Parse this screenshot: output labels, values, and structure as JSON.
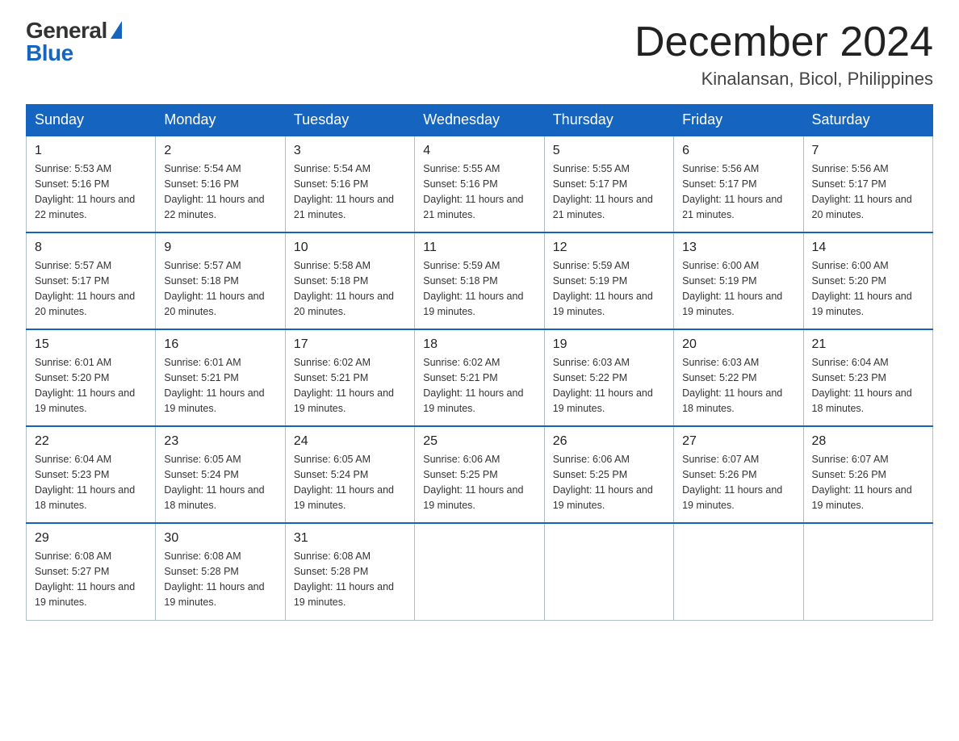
{
  "logo": {
    "text_general": "General",
    "text_blue": "Blue",
    "aria": "GeneralBlue logo"
  },
  "header": {
    "month_title": "December 2024",
    "location": "Kinalansan, Bicol, Philippines"
  },
  "days_of_week": [
    "Sunday",
    "Monday",
    "Tuesday",
    "Wednesday",
    "Thursday",
    "Friday",
    "Saturday"
  ],
  "weeks": [
    [
      {
        "day": "1",
        "sunrise": "Sunrise: 5:53 AM",
        "sunset": "Sunset: 5:16 PM",
        "daylight": "Daylight: 11 hours and 22 minutes."
      },
      {
        "day": "2",
        "sunrise": "Sunrise: 5:54 AM",
        "sunset": "Sunset: 5:16 PM",
        "daylight": "Daylight: 11 hours and 22 minutes."
      },
      {
        "day": "3",
        "sunrise": "Sunrise: 5:54 AM",
        "sunset": "Sunset: 5:16 PM",
        "daylight": "Daylight: 11 hours and 21 minutes."
      },
      {
        "day": "4",
        "sunrise": "Sunrise: 5:55 AM",
        "sunset": "Sunset: 5:16 PM",
        "daylight": "Daylight: 11 hours and 21 minutes."
      },
      {
        "day": "5",
        "sunrise": "Sunrise: 5:55 AM",
        "sunset": "Sunset: 5:17 PM",
        "daylight": "Daylight: 11 hours and 21 minutes."
      },
      {
        "day": "6",
        "sunrise": "Sunrise: 5:56 AM",
        "sunset": "Sunset: 5:17 PM",
        "daylight": "Daylight: 11 hours and 21 minutes."
      },
      {
        "day": "7",
        "sunrise": "Sunrise: 5:56 AM",
        "sunset": "Sunset: 5:17 PM",
        "daylight": "Daylight: 11 hours and 20 minutes."
      }
    ],
    [
      {
        "day": "8",
        "sunrise": "Sunrise: 5:57 AM",
        "sunset": "Sunset: 5:17 PM",
        "daylight": "Daylight: 11 hours and 20 minutes."
      },
      {
        "day": "9",
        "sunrise": "Sunrise: 5:57 AM",
        "sunset": "Sunset: 5:18 PM",
        "daylight": "Daylight: 11 hours and 20 minutes."
      },
      {
        "day": "10",
        "sunrise": "Sunrise: 5:58 AM",
        "sunset": "Sunset: 5:18 PM",
        "daylight": "Daylight: 11 hours and 20 minutes."
      },
      {
        "day": "11",
        "sunrise": "Sunrise: 5:59 AM",
        "sunset": "Sunset: 5:18 PM",
        "daylight": "Daylight: 11 hours and 19 minutes."
      },
      {
        "day": "12",
        "sunrise": "Sunrise: 5:59 AM",
        "sunset": "Sunset: 5:19 PM",
        "daylight": "Daylight: 11 hours and 19 minutes."
      },
      {
        "day": "13",
        "sunrise": "Sunrise: 6:00 AM",
        "sunset": "Sunset: 5:19 PM",
        "daylight": "Daylight: 11 hours and 19 minutes."
      },
      {
        "day": "14",
        "sunrise": "Sunrise: 6:00 AM",
        "sunset": "Sunset: 5:20 PM",
        "daylight": "Daylight: 11 hours and 19 minutes."
      }
    ],
    [
      {
        "day": "15",
        "sunrise": "Sunrise: 6:01 AM",
        "sunset": "Sunset: 5:20 PM",
        "daylight": "Daylight: 11 hours and 19 minutes."
      },
      {
        "day": "16",
        "sunrise": "Sunrise: 6:01 AM",
        "sunset": "Sunset: 5:21 PM",
        "daylight": "Daylight: 11 hours and 19 minutes."
      },
      {
        "day": "17",
        "sunrise": "Sunrise: 6:02 AM",
        "sunset": "Sunset: 5:21 PM",
        "daylight": "Daylight: 11 hours and 19 minutes."
      },
      {
        "day": "18",
        "sunrise": "Sunrise: 6:02 AM",
        "sunset": "Sunset: 5:21 PM",
        "daylight": "Daylight: 11 hours and 19 minutes."
      },
      {
        "day": "19",
        "sunrise": "Sunrise: 6:03 AM",
        "sunset": "Sunset: 5:22 PM",
        "daylight": "Daylight: 11 hours and 19 minutes."
      },
      {
        "day": "20",
        "sunrise": "Sunrise: 6:03 AM",
        "sunset": "Sunset: 5:22 PM",
        "daylight": "Daylight: 11 hours and 18 minutes."
      },
      {
        "day": "21",
        "sunrise": "Sunrise: 6:04 AM",
        "sunset": "Sunset: 5:23 PM",
        "daylight": "Daylight: 11 hours and 18 minutes."
      }
    ],
    [
      {
        "day": "22",
        "sunrise": "Sunrise: 6:04 AM",
        "sunset": "Sunset: 5:23 PM",
        "daylight": "Daylight: 11 hours and 18 minutes."
      },
      {
        "day": "23",
        "sunrise": "Sunrise: 6:05 AM",
        "sunset": "Sunset: 5:24 PM",
        "daylight": "Daylight: 11 hours and 18 minutes."
      },
      {
        "day": "24",
        "sunrise": "Sunrise: 6:05 AM",
        "sunset": "Sunset: 5:24 PM",
        "daylight": "Daylight: 11 hours and 19 minutes."
      },
      {
        "day": "25",
        "sunrise": "Sunrise: 6:06 AM",
        "sunset": "Sunset: 5:25 PM",
        "daylight": "Daylight: 11 hours and 19 minutes."
      },
      {
        "day": "26",
        "sunrise": "Sunrise: 6:06 AM",
        "sunset": "Sunset: 5:25 PM",
        "daylight": "Daylight: 11 hours and 19 minutes."
      },
      {
        "day": "27",
        "sunrise": "Sunrise: 6:07 AM",
        "sunset": "Sunset: 5:26 PM",
        "daylight": "Daylight: 11 hours and 19 minutes."
      },
      {
        "day": "28",
        "sunrise": "Sunrise: 6:07 AM",
        "sunset": "Sunset: 5:26 PM",
        "daylight": "Daylight: 11 hours and 19 minutes."
      }
    ],
    [
      {
        "day": "29",
        "sunrise": "Sunrise: 6:08 AM",
        "sunset": "Sunset: 5:27 PM",
        "daylight": "Daylight: 11 hours and 19 minutes."
      },
      {
        "day": "30",
        "sunrise": "Sunrise: 6:08 AM",
        "sunset": "Sunset: 5:28 PM",
        "daylight": "Daylight: 11 hours and 19 minutes."
      },
      {
        "day": "31",
        "sunrise": "Sunrise: 6:08 AM",
        "sunset": "Sunset: 5:28 PM",
        "daylight": "Daylight: 11 hours and 19 minutes."
      },
      null,
      null,
      null,
      null
    ]
  ]
}
